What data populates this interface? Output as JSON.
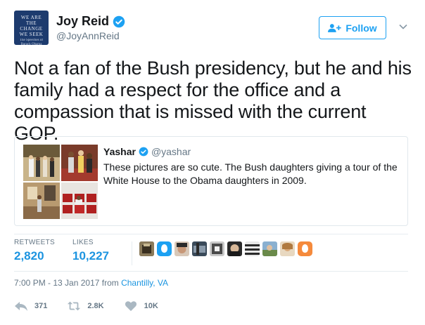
{
  "author": {
    "name": "Joy Reid",
    "handle": "@JoyAnnReid",
    "avatar_text_1": "WE ARE\nTHE CHANGE\nWE SEEK",
    "avatar_text_2": "The Speeches of\nBarack Obama"
  },
  "follow_label": "Follow",
  "tweet_text": "Not a fan of the Bush presidency, but he and his\nfamily  had a respect for the office and a\ncompassion that is missed with the current GOP.",
  "quoted": {
    "name": "Yashar",
    "handle": "@yashar",
    "text": "These pictures are so cute. The Bush daughters giving a tour of the White House to the Obama daughters in 2009."
  },
  "stats": {
    "retweets_label": "RETWEETS",
    "retweets_value": "2,820",
    "likes_label": "LIKES",
    "likes_value": "10,227"
  },
  "timestamp": "7:00 PM - 13 Jan 2017 from ",
  "location": "Chantilly, VA",
  "actions": {
    "replies": "371",
    "retweets": "2.8K",
    "likes": "10K"
  },
  "colors": {
    "accent": "#1da1f2",
    "link": "#1b95e0",
    "muted": "#657786"
  },
  "icons": [
    "verified-icon",
    "add-user-icon",
    "chevron-down-icon",
    "reply-icon",
    "retweet-icon",
    "heart-icon"
  ]
}
